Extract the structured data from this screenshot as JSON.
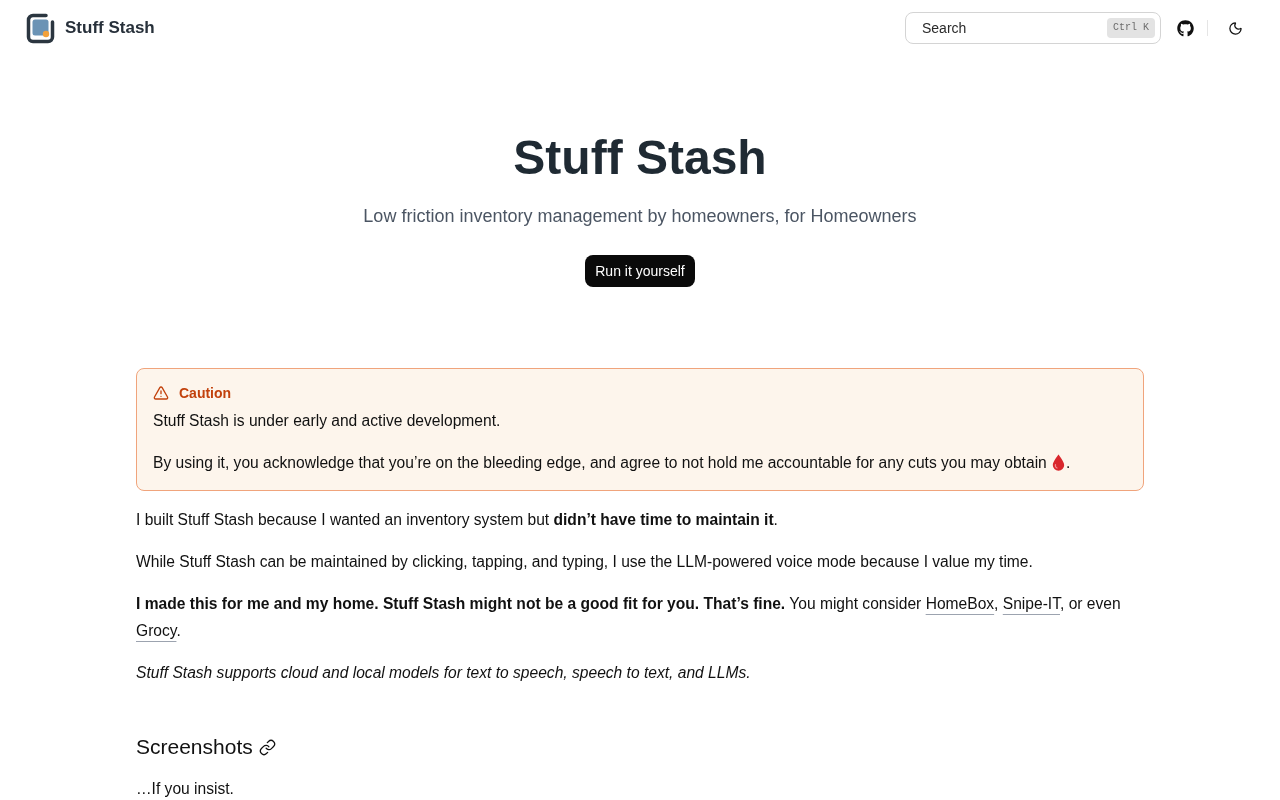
{
  "header": {
    "brand": "Stuff Stash",
    "search": {
      "placeholder": "Search",
      "shortcut": "Ctrl K"
    }
  },
  "hero": {
    "title": "Stuff Stash",
    "subtitle": "Low friction inventory management by homeowners, for Homeowners",
    "button": "Run it yourself"
  },
  "callout": {
    "title": "Caution",
    "paragraphs": [
      [
        {
          "kind": "text",
          "text": "Stuff Stash is under early and active development."
        }
      ],
      [
        {
          "kind": "text",
          "text": "By using it, you acknowledge that you’re on the bleeding edge, and agree to not hold me accountable for any cuts you may obtain "
        },
        {
          "kind": "icon"
        },
        {
          "kind": "text",
          "text": "."
        }
      ]
    ]
  },
  "paragraphs": [
    {
      "kind": "body",
      "parts": [
        {
          "kind": "text",
          "text": "I built Stuff Stash because I wanted an inventory system but **didn’t have time to maintain it**."
        }
      ]
    },
    {
      "kind": "body",
      "parts": [
        {
          "kind": "text",
          "text": "While Stuff Stash can be maintained by clicking, tapping, and typing, I use the LLM-powered voice mode because I value my time."
        }
      ]
    },
    {
      "kind": "body",
      "parts": [
        {
          "kind": "text",
          "text": "**I made this for me and my home. Stuff Stash might not be a good fit for you. That’s fine.** You might consider "
        },
        {
          "kind": "link",
          "text": "HomeBox"
        },
        {
          "kind": "text",
          "text": ", "
        },
        {
          "kind": "link",
          "text": "Snipe-IT"
        },
        {
          "kind": "text",
          "text": ", or even "
        },
        {
          "kind": "link",
          "text": "Grocy"
        },
        {
          "kind": "text",
          "text": "."
        }
      ]
    },
    {
      "kind": "note",
      "parts": [
        {
          "kind": "text",
          "text": "Stuff Stash supports cloud and local models for text to speech, speech to text, and LLMs."
        }
      ]
    }
  ],
  "section": {
    "heading": "Screenshots",
    "paragraphs": [
      {
        "kind": "body",
        "parts": [
          {
            "kind": "text",
            "text": "…If you insist."
          }
        ]
      }
    ]
  }
}
